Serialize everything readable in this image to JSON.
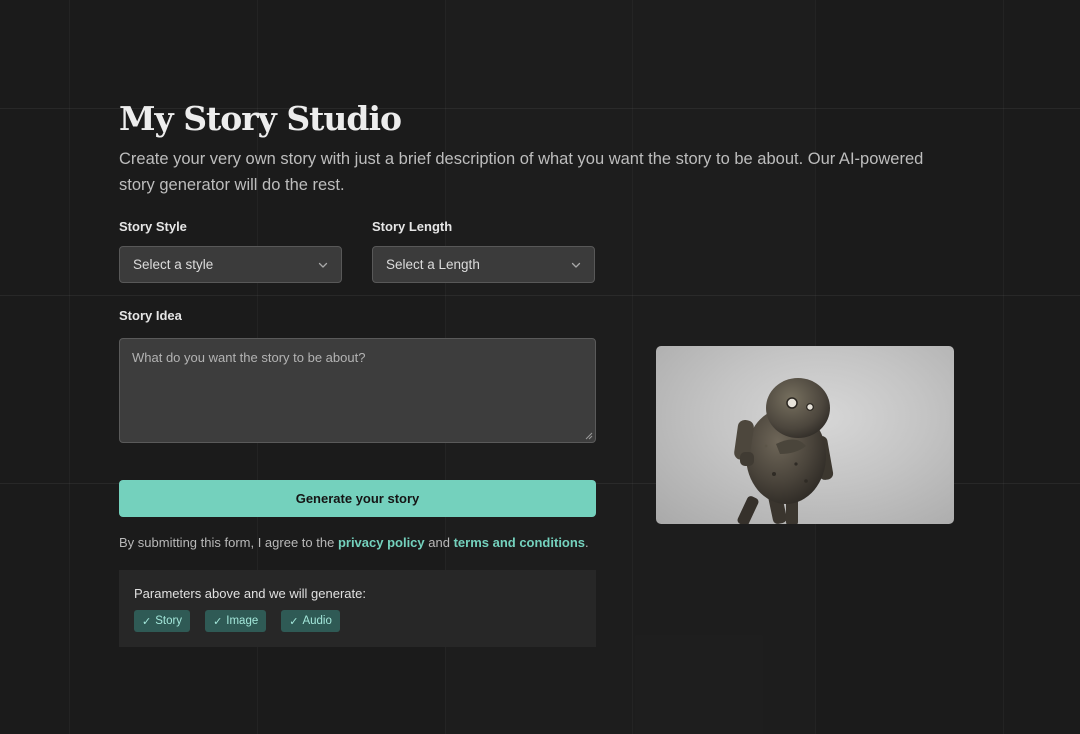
{
  "page": {
    "title": "My Story Studio",
    "subtitle": "Create your very own story with just a brief description of what you want the story to be about. Our AI-powered story generator will do the rest."
  },
  "form": {
    "style": {
      "label": "Story Style",
      "value": "Select a style"
    },
    "length": {
      "label": "Story Length",
      "value": "Select a Length"
    },
    "idea": {
      "label": "Story Idea",
      "placeholder": "What do you want the story to be about?"
    },
    "submit_label": "Generate your story"
  },
  "agreement": {
    "prefix": "By submitting this form, I agree to the ",
    "privacy_link": "privacy policy",
    "middle": " and ",
    "terms_link": "terms and conditions",
    "suffix": "."
  },
  "params": {
    "text": "Parameters above and we will generate:",
    "badges": [
      "Story",
      "Image",
      "Audio"
    ]
  },
  "colors": {
    "accent": "#74d1bd",
    "background": "#1b1b1b",
    "badge_bg": "#2f5a55"
  },
  "icons": {
    "dropdown": "chevron-down-icon",
    "badge": "check-icon"
  }
}
